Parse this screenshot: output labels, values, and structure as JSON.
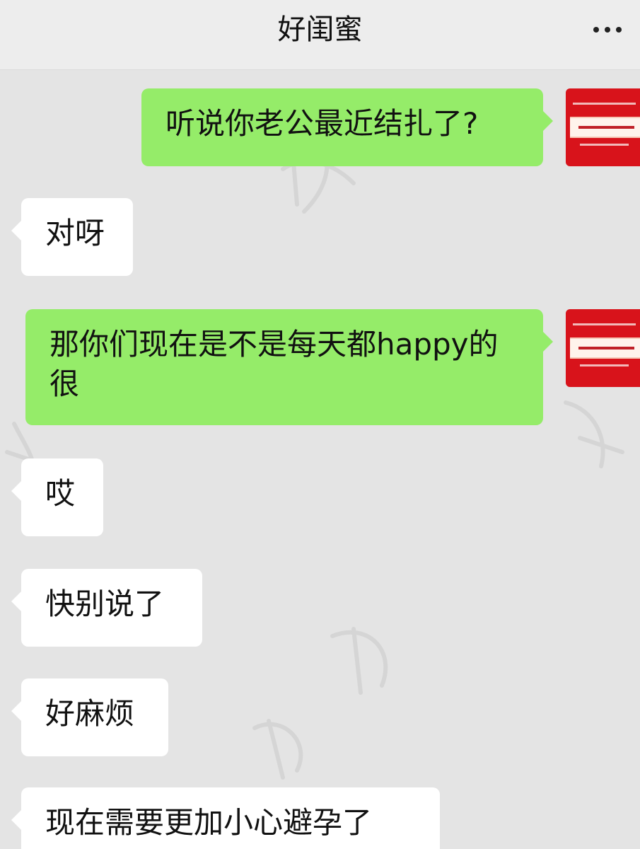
{
  "header": {
    "title": "好闺蜜",
    "more_icon": "more-dots-icon"
  },
  "messages": [
    {
      "side": "sent",
      "text": "听说你老公最近结扎了?"
    },
    {
      "side": "received",
      "text": "对呀"
    },
    {
      "side": "sent",
      "text": "那你们现在是不是每天都happy的很"
    },
    {
      "side": "received",
      "text": "哎"
    },
    {
      "side": "received",
      "text": "快别说了"
    },
    {
      "side": "received",
      "text": "好麻烦"
    },
    {
      "side": "received",
      "text": "现在需要更加小心避孕了"
    }
  ],
  "colors": {
    "sent_bubble": "#95ec69",
    "received_bubble": "#ffffff",
    "chat_background": "#e4e4e4",
    "header_background": "#ededed",
    "avatar_red": "#d8131b"
  }
}
